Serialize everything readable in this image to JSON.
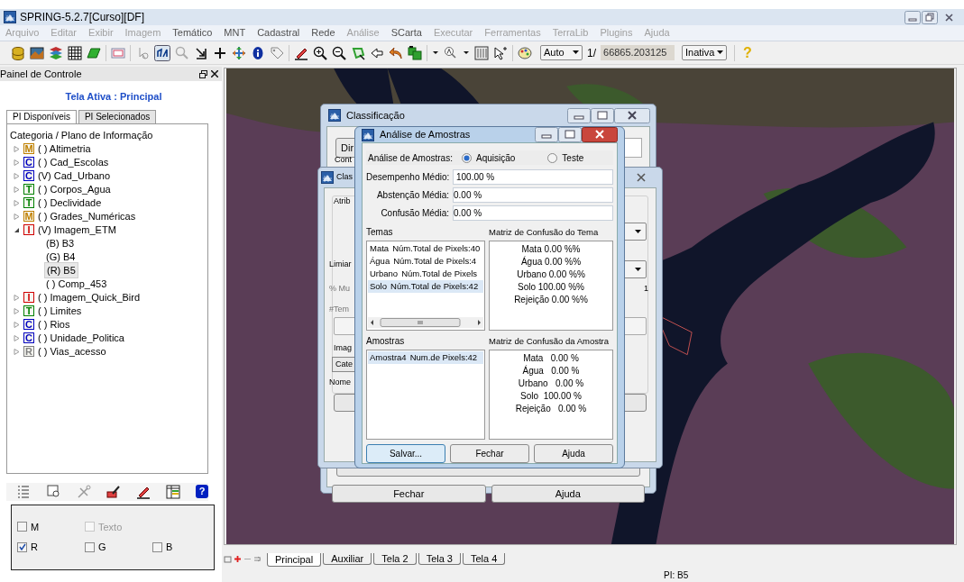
{
  "window": {
    "title": "SPRING-5.2.7[Curso][DF]"
  },
  "menu": [
    {
      "label": "Arquivo",
      "disabled": true
    },
    {
      "label": "Editar",
      "disabled": true
    },
    {
      "label": "Exibir",
      "disabled": true
    },
    {
      "label": "Imagem",
      "disabled": true
    },
    {
      "label": "Temático",
      "disabled": false
    },
    {
      "label": "MNT",
      "disabled": false
    },
    {
      "label": "Cadastral",
      "disabled": false
    },
    {
      "label": "Rede",
      "disabled": false
    },
    {
      "label": "Análise",
      "disabled": true
    },
    {
      "label": "SCarta",
      "disabled": false
    },
    {
      "label": "Executar",
      "disabled": true
    },
    {
      "label": "Ferramentas",
      "disabled": true
    },
    {
      "label": "TerraLib",
      "disabled": true
    },
    {
      "label": "Plugins",
      "disabled": true
    },
    {
      "label": "Ajuda",
      "disabled": true
    }
  ],
  "toolbar": {
    "scale_mode": "Auto",
    "scale_prefix": "1/",
    "scale_value": "66865.203125",
    "edit_mode": "Inativa",
    "help_label": "?"
  },
  "control_panel": {
    "title": "Painel de Controle",
    "active_screen": "Tela Ativa : Principal",
    "tabs": [
      {
        "label": "PI Disponíveis",
        "selected": true
      },
      {
        "label": "PI Selecionados",
        "selected": false
      }
    ],
    "tree_header": "Categoria / Plano de Informação",
    "tree": [
      {
        "badge": "M",
        "color": "#c08000",
        "label": "( ) Altimetria",
        "expanded": false
      },
      {
        "badge": "C",
        "color": "#0000c0",
        "label": "( ) Cad_Escolas",
        "expanded": false
      },
      {
        "badge": "C",
        "color": "#0000c0",
        "label": "(V) Cad_Urbano",
        "expanded": false
      },
      {
        "badge": "T",
        "color": "#008000",
        "label": "( ) Corpos_Agua",
        "expanded": false
      },
      {
        "badge": "T",
        "color": "#008000",
        "label": "( ) Declividade",
        "expanded": false
      },
      {
        "badge": "M",
        "color": "#c08000",
        "label": "( ) Grades_Numéricas",
        "expanded": false
      },
      {
        "badge": "I",
        "color": "#d00000",
        "label": "(V) Imagem_ETM",
        "expanded": true,
        "children": [
          {
            "label": "(B) B3",
            "selected": false
          },
          {
            "label": "(G) B4",
            "selected": false
          },
          {
            "label": "(R) B5",
            "selected": true
          },
          {
            "label": "( ) Comp_453",
            "selected": false
          }
        ]
      },
      {
        "badge": "I",
        "color": "#d00000",
        "label": "( ) Imagem_Quick_Bird",
        "expanded": false
      },
      {
        "badge": "T",
        "color": "#008000",
        "label": "( ) Limites",
        "expanded": false
      },
      {
        "badge": "C",
        "color": "#0000c0",
        "label": "( ) Rios",
        "expanded": false
      },
      {
        "badge": "C",
        "color": "#0000c0",
        "label": "( ) Unidade_Politica",
        "expanded": false
      },
      {
        "badge": "R",
        "color": "#808080",
        "label": "( ) Vias_acesso",
        "expanded": false
      }
    ],
    "help_label": "?",
    "checkboxes": [
      {
        "label": "M",
        "checked": false,
        "disabled": false
      },
      {
        "label": "Texto",
        "checked": false,
        "disabled": true
      },
      {
        "label": "R",
        "checked": true,
        "disabled": false
      },
      {
        "label": "G",
        "checked": false,
        "disabled": false
      },
      {
        "label": "B",
        "checked": false,
        "disabled": false
      }
    ]
  },
  "map": {
    "tabs": [
      {
        "label": "Principal",
        "selected": true
      },
      {
        "label": "Auxiliar",
        "selected": false
      },
      {
        "label": "Tela 2",
        "selected": false
      },
      {
        "label": "Tela 3",
        "selected": false
      },
      {
        "label": "Tela 4",
        "selected": false
      }
    ],
    "status": "PI: B5"
  },
  "classification_dialog": {
    "title": "Classificação",
    "cut_button": "Dir",
    "cut_label": "Cont",
    "close_button": "Fechar",
    "help_button": "Ajuda"
  },
  "second_dialog": {
    "title": "Clas",
    "fragments": [
      "Atrib",
      "Limiar",
      "% Mu",
      "1",
      "#Tem",
      "Imag",
      "Cate",
      "Nome"
    ]
  },
  "sample_dialog": {
    "title": "Análise de Amostras",
    "mode_label": "Análise de Amostras:",
    "modes": [
      {
        "label": "Aquisição",
        "selected": true
      },
      {
        "label": "Teste",
        "selected": false
      }
    ],
    "fields": [
      {
        "label": "Desempenho Médio:",
        "value": "100.00 %"
      },
      {
        "label": "Abstenção Média:",
        "value": "0.00 %"
      },
      {
        "label": "Confusão Média:",
        "value": "0.00 %"
      }
    ],
    "themes_title": "Temas",
    "themes": [
      {
        "name": "Mata",
        "info": "Núm.Total de Pixels:40",
        "selected": false
      },
      {
        "name": "Água",
        "info": "Núm.Total de Pixels:4",
        "selected": false
      },
      {
        "name": "Urbano",
        "info": "Núm.Total de Pixels",
        "selected": false
      },
      {
        "name": "Solo",
        "info": "Núm.Total de Pixels:42",
        "selected": true
      }
    ],
    "theme_matrix_title": "Matriz de Confusão do Tema",
    "theme_matrix": [
      "Mata 0.00 %%",
      "Água 0.00 %%",
      "Urbano 0.00 %%",
      "Solo 100.00 %%",
      "Rejeição 0.00 %%"
    ],
    "samples_title": "Amostras",
    "samples": [
      {
        "name": "Amostra4",
        "info": "Num.de Pixels:42",
        "selected": true
      }
    ],
    "sample_matrix_title": "Matriz de Confusão da Amostra",
    "sample_matrix": [
      "Mata   0.00 %",
      "Água   0.00 %",
      "Urbano   0.00 %",
      "Solo  100.00 %",
      "Rejeição   0.00 %"
    ],
    "buttons": [
      "Salvar...",
      "Fechar",
      "Ajuda"
    ]
  }
}
